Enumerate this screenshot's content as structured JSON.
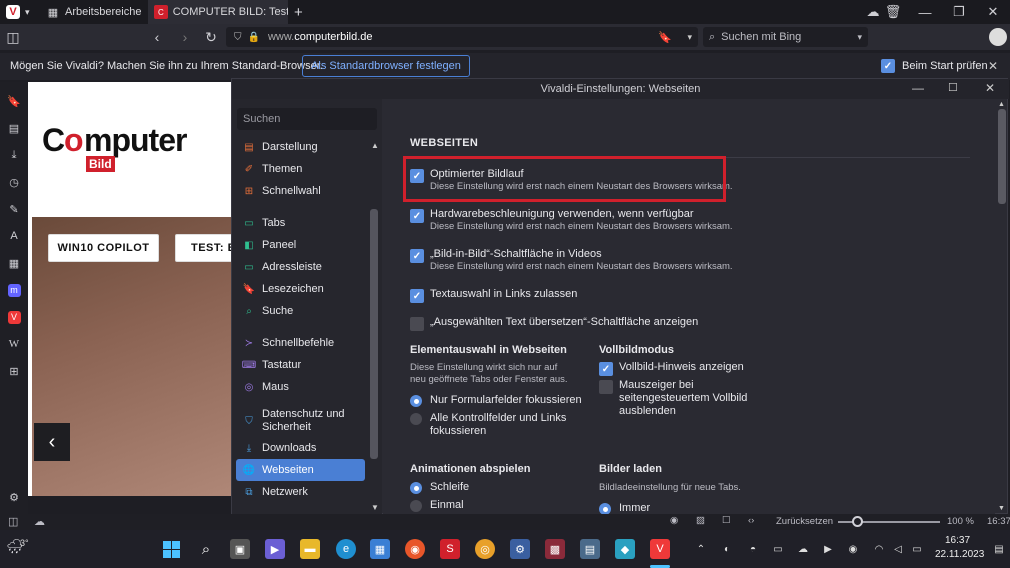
{
  "tabbar": {
    "workspaces_label": "Arbeitsbereiche",
    "active_tab_title": "COMPUTER BILD: Test, Dow",
    "new_tab_icon": "plus-icon",
    "window_controls": [
      "minimize",
      "maximize",
      "close"
    ]
  },
  "navbar": {
    "url_prefix": "www.",
    "url_domain": "computerbild",
    "url_suffix": ".de",
    "search_placeholder": "Suchen mit Bing"
  },
  "infobar": {
    "message": "Mögen Sie Vivaldi? Machen Sie ihn zu Ihrem Standard-Browser.",
    "button_label": "Als Standardbrowser festlegen",
    "checkbox_label": "Beim Start prüfen",
    "checkbox_checked": true
  },
  "page": {
    "logo_top": "C",
    "logo_word": "mputer",
    "logo_o": "o",
    "logo_bild": "Bild",
    "pills": [
      "WIN10 COPILOT",
      "TEST: EX"
    ],
    "prev_arrow": "‹"
  },
  "settings": {
    "window_title": "Vivaldi-Einstellungen: Webseiten",
    "search_placeholder": "Suchen",
    "sidebar": [
      {
        "label": "Darstellung",
        "icon": "palette-icon",
        "color": "#e8703a"
      },
      {
        "label": "Themen",
        "icon": "brush-icon",
        "color": "#e8703a"
      },
      {
        "label": "Schnellwahl",
        "icon": "grid-plus-icon",
        "color": "#e8703a"
      },
      {
        "label": "Tabs",
        "icon": "tabs-icon",
        "color": "#2fbf8f"
      },
      {
        "label": "Paneel",
        "icon": "panel-icon",
        "color": "#2fbf8f"
      },
      {
        "label": "Adressleiste",
        "icon": "address-bar-icon",
        "color": "#2fbf8f"
      },
      {
        "label": "Lesezeichen",
        "icon": "bookmark-icon",
        "color": "#2fbf8f"
      },
      {
        "label": "Suche",
        "icon": "search-icon",
        "color": "#2fbf8f"
      },
      {
        "label": "Schnellbefehle",
        "icon": "quick-commands-icon",
        "color": "#a07ce8"
      },
      {
        "label": "Tastatur",
        "icon": "keyboard-icon",
        "color": "#a07ce8"
      },
      {
        "label": "Maus",
        "icon": "mouse-icon",
        "color": "#a07ce8"
      },
      {
        "label": "Datenschutz und Sicherheit",
        "icon": "shield-icon",
        "color": "#4a9fe0"
      },
      {
        "label": "Downloads",
        "icon": "download-icon",
        "color": "#4a9fe0"
      },
      {
        "label": "Webseiten",
        "icon": "globe-icon",
        "color": "#ffffff"
      },
      {
        "label": "Netzwerk",
        "icon": "network-icon",
        "color": "#4a9fe0"
      }
    ],
    "section_title": "WEBSEITEN",
    "options": [
      {
        "label": "Optimierter Bildlauf",
        "sub": "Diese Einstellung wird erst nach einem Neustart des Browsers wirksam.",
        "checked": true
      },
      {
        "label": "Hardwarebeschleunigung verwenden, wenn verfügbar",
        "sub": "Diese Einstellung wird erst nach einem Neustart des Browsers wirksam.",
        "checked": true
      },
      {
        "label": "„Bild-in-Bild“-Schaltfläche in Videos",
        "sub": "Diese Einstellung wird erst nach einem Neustart des Browsers wirksam.",
        "checked": true
      },
      {
        "label": "Textauswahl in Links zulassen",
        "sub": "",
        "checked": true
      },
      {
        "label": "„Ausgewählten Text übersetzen“-Schaltfläche anzeigen",
        "sub": "",
        "checked": false
      }
    ],
    "element_selection": {
      "title": "Elementauswahl in Webseiten",
      "desc1": "Diese Einstellung wirkt sich nur auf",
      "desc2": "neu geöffnete Tabs oder Fenster aus.",
      "radio1": "Nur Formularfelder fokussieren",
      "radio2a": "Alle Kontrollfelder und Links",
      "radio2b": "fokussieren"
    },
    "fullscreen": {
      "title": "Vollbildmodus",
      "opt1": "Vollbild-Hinweis anzeigen",
      "opt2a": "Mauszeiger bei",
      "opt2b": "seitengesteuertem Vollbild",
      "opt2c": "ausblenden"
    },
    "animations": {
      "title": "Animationen abspielen",
      "radio1": "Schleife",
      "radio2": "Einmal"
    },
    "images": {
      "title": "Bilder laden",
      "desc": "Bildladeeinstellung für neue Tabs.",
      "radio1": "Immer"
    }
  },
  "statusbar": {
    "reset_label": "Zurücksetzen",
    "zoom": "100 %",
    "time": "16:37"
  },
  "taskbar": {
    "weather": "3°",
    "time": "16:37",
    "date": "22.11.2023"
  }
}
